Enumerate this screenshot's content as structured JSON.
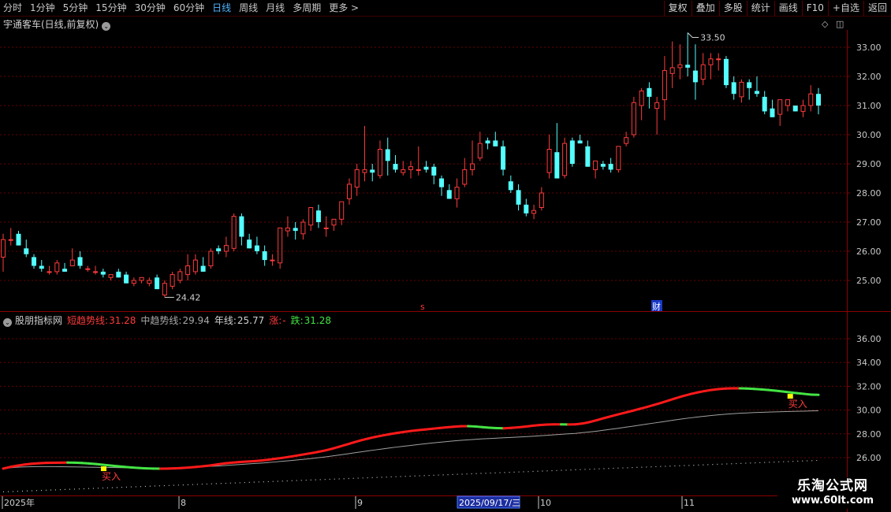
{
  "toolbar": {
    "periods": [
      "分时",
      "1分钟",
      "5分钟",
      "15分钟",
      "30分钟",
      "60分钟",
      "日线",
      "周线",
      "月线",
      "多周期",
      "更多 >"
    ],
    "active_period": "日线",
    "actions": [
      "复权",
      "叠加",
      "多股",
      "统计",
      "画线",
      "F10",
      "+自选",
      "返回"
    ]
  },
  "main_chart": {
    "title": "宇通客车(日线,前复权)",
    "high_label": "33.50",
    "low_label": "24.42",
    "price_ticks": [
      "33.00",
      "32.00",
      "31.00",
      "30.00",
      "29.00",
      "28.00",
      "27.00",
      "26.00",
      "25.00"
    ],
    "marker_s": "s",
    "marker_cai": "财"
  },
  "indicator": {
    "name": "股朋指标网",
    "short_label": "短趋势线:",
    "short_value": "31.28",
    "mid_label": "中趋势线:",
    "mid_value": "29.94",
    "year_label": "年线:",
    "year_value": "25.77",
    "up_label": "涨:",
    "up_value": "-",
    "down_label": "跌:",
    "down_value": "31.28",
    "ticks": [
      "36.00",
      "34.00",
      "32.00",
      "30.00",
      "28.00",
      "26.00"
    ],
    "buy_label": "买入"
  },
  "date_axis": {
    "labels": [
      "2025年",
      "8",
      "9",
      "10",
      "11"
    ],
    "cursor_date": "2025/09/17/三"
  },
  "logo": {
    "line1": "乐淘公式网",
    "line2": "www.60lt.com"
  },
  "colors": {
    "up": "#ff3b3b",
    "down": "#54ffff",
    "trend_up": "#ff1a1a",
    "trend_down": "#44e444",
    "mid": "#a0a0a0",
    "grid": "#6a0000",
    "buy_marker": "#ffff00"
  },
  "chart_data": {
    "type": "candlestick",
    "candles": [
      [
        25.8,
        26.6,
        25.3,
        26.4
      ],
      [
        26.4,
        26.8,
        26.2,
        26.4
      ],
      [
        26.6,
        26.7,
        26.2,
        26.2
      ],
      [
        26.1,
        26.4,
        25.8,
        25.9
      ],
      [
        25.8,
        25.9,
        25.4,
        25.5
      ],
      [
        25.5,
        25.7,
        25.3,
        25.4
      ],
      [
        25.3,
        25.5,
        25.2,
        25.3
      ],
      [
        25.3,
        25.7,
        25.2,
        25.6
      ],
      [
        25.4,
        25.6,
        25.3,
        25.3
      ],
      [
        25.5,
        26.1,
        25.5,
        25.7
      ],
      [
        25.8,
        26.0,
        25.4,
        25.5
      ],
      [
        25.4,
        25.5,
        25.3,
        25.4
      ],
      [
        25.3,
        25.5,
        25.2,
        25.3
      ],
      [
        25.3,
        25.4,
        25.1,
        25.2
      ],
      [
        25.1,
        25.2,
        25.0,
        25.2
      ],
      [
        25.3,
        25.4,
        25.1,
        25.1
      ],
      [
        25.2,
        25.3,
        24.9,
        24.9
      ],
      [
        24.9,
        25.1,
        24.8,
        25.0
      ],
      [
        25.0,
        25.1,
        24.9,
        25.1
      ],
      [
        24.9,
        25.1,
        24.8,
        25.0
      ],
      [
        25.1,
        25.2,
        24.7,
        24.7
      ],
      [
        24.5,
        25.0,
        24.42,
        24.9
      ],
      [
        24.8,
        25.3,
        24.7,
        25.2
      ],
      [
        25.0,
        25.4,
        24.9,
        25.3
      ],
      [
        25.2,
        25.9,
        25.0,
        25.5
      ],
      [
        25.3,
        25.9,
        25.2,
        25.7
      ],
      [
        25.5,
        25.8,
        25.3,
        25.3
      ],
      [
        25.5,
        26.1,
        25.4,
        26.0
      ],
      [
        26.1,
        26.2,
        25.9,
        26.0
      ],
      [
        26.0,
        26.5,
        25.8,
        26.2
      ],
      [
        26.1,
        27.3,
        26.0,
        27.2
      ],
      [
        27.2,
        27.3,
        26.2,
        26.5
      ],
      [
        26.4,
        26.6,
        26.1,
        26.1
      ],
      [
        26.2,
        26.5,
        25.9,
        26.0
      ],
      [
        26.0,
        26.2,
        25.5,
        25.7
      ],
      [
        25.7,
        25.9,
        25.5,
        25.7
      ],
      [
        25.6,
        26.8,
        25.4,
        26.8
      ],
      [
        26.7,
        27.2,
        26.5,
        26.8
      ],
      [
        26.8,
        27.0,
        26.4,
        26.7
      ],
      [
        26.6,
        27.1,
        26.4,
        27.0
      ],
      [
        26.9,
        27.4,
        26.7,
        27.5
      ],
      [
        27.4,
        27.6,
        26.8,
        27.0
      ],
      [
        26.8,
        27.2,
        26.5,
        26.8
      ],
      [
        26.9,
        27.1,
        26.7,
        27.1
      ],
      [
        27.1,
        27.5,
        26.9,
        27.7
      ],
      [
        27.8,
        28.5,
        27.6,
        28.3
      ],
      [
        28.2,
        29.0,
        27.9,
        28.8
      ],
      [
        28.7,
        30.3,
        28.4,
        28.8
      ],
      [
        28.8,
        29.0,
        28.4,
        28.7
      ],
      [
        28.6,
        29.8,
        28.5,
        29.5
      ],
      [
        29.5,
        29.9,
        28.6,
        29.1
      ],
      [
        29.0,
        29.3,
        28.7,
        28.8
      ],
      [
        28.7,
        29.1,
        28.6,
        28.8
      ],
      [
        28.8,
        29.1,
        28.5,
        28.9
      ],
      [
        28.8,
        29.6,
        28.6,
        28.8
      ],
      [
        28.9,
        29.1,
        28.7,
        28.8
      ],
      [
        28.9,
        29.0,
        28.3,
        28.6
      ],
      [
        28.5,
        28.6,
        27.9,
        28.2
      ],
      [
        28.1,
        28.3,
        27.8,
        27.8
      ],
      [
        27.8,
        28.5,
        27.5,
        28.2
      ],
      [
        28.3,
        29.2,
        28.2,
        28.8
      ],
      [
        28.8,
        29.8,
        28.6,
        29.0
      ],
      [
        29.2,
        30.1,
        29.1,
        29.7
      ],
      [
        29.8,
        29.9,
        29.5,
        29.7
      ],
      [
        29.8,
        30.1,
        29.6,
        29.6
      ],
      [
        29.6,
        29.8,
        28.6,
        28.8
      ],
      [
        28.4,
        28.6,
        28.0,
        28.1
      ],
      [
        28.1,
        28.3,
        27.4,
        27.6
      ],
      [
        27.6,
        27.8,
        27.2,
        27.3
      ],
      [
        27.3,
        27.6,
        27.1,
        27.4
      ],
      [
        27.5,
        28.2,
        27.4,
        28.0
      ],
      [
        28.7,
        30.0,
        28.5,
        29.5
      ],
      [
        29.4,
        30.4,
        28.5,
        28.5
      ],
      [
        28.6,
        29.9,
        28.5,
        29.7
      ],
      [
        29.8,
        29.9,
        28.9,
        29.0
      ],
      [
        29.8,
        30.0,
        29.7,
        29.7
      ],
      [
        29.6,
        29.8,
        28.9,
        28.9
      ],
      [
        28.8,
        29.0,
        28.5,
        29.1
      ],
      [
        29.0,
        29.1,
        28.8,
        28.9
      ],
      [
        29.0,
        29.2,
        28.7,
        28.8
      ],
      [
        28.8,
        29.2,
        28.7,
        29.6
      ],
      [
        29.7,
        30.1,
        29.6,
        29.9
      ],
      [
        30.0,
        31.3,
        29.9,
        31.1
      ],
      [
        31.0,
        31.6,
        30.5,
        31.5
      ],
      [
        31.6,
        31.8,
        30.9,
        31.3
      ],
      [
        30.9,
        31.3,
        30.0,
        31.1
      ],
      [
        31.2,
        32.7,
        30.5,
        32.2
      ],
      [
        32.1,
        33.2,
        31.6,
        32.3
      ],
      [
        32.3,
        33.1,
        31.9,
        32.4
      ],
      [
        32.4,
        33.5,
        32.0,
        32.3
      ],
      [
        32.2,
        33.1,
        31.2,
        31.8
      ],
      [
        31.9,
        32.8,
        31.7,
        32.4
      ],
      [
        32.4,
        32.8,
        31.9,
        32.6
      ],
      [
        32.6,
        32.8,
        32.2,
        32.6
      ],
      [
        32.6,
        32.7,
        31.6,
        31.7
      ],
      [
        31.8,
        32.0,
        31.2,
        31.4
      ],
      [
        31.3,
        31.9,
        31.1,
        31.8
      ],
      [
        31.8,
        31.9,
        31.2,
        31.6
      ],
      [
        31.5,
        32.0,
        31.3,
        31.4
      ],
      [
        31.3,
        31.5,
        30.7,
        30.8
      ],
      [
        30.9,
        31.2,
        30.6,
        30.6
      ],
      [
        30.7,
        31.0,
        30.3,
        31.2
      ],
      [
        31.0,
        31.2,
        30.8,
        31.2
      ],
      [
        31.0,
        31.0,
        30.8,
        30.8
      ],
      [
        30.8,
        31.2,
        30.6,
        31.0
      ],
      [
        31.0,
        31.7,
        30.8,
        31.4
      ],
      [
        31.4,
        31.6,
        30.7,
        31.0
      ]
    ],
    "short_trend": [
      25.08,
      25.22,
      25.33,
      25.42,
      25.49,
      25.53,
      25.56,
      25.57,
      25.58,
      25.59,
      25.58,
      25.55,
      25.51,
      25.46,
      25.4,
      25.34,
      25.28,
      25.22,
      25.17,
      25.13,
      25.1,
      25.08,
      25.07,
      25.08,
      25.1,
      25.13,
      25.17,
      25.22,
      25.28,
      25.35,
      25.44,
      25.52,
      25.58,
      25.63,
      25.67,
      25.7,
      25.75,
      25.82,
      25.9,
      25.98,
      26.07,
      26.17,
      26.27,
      26.37,
      26.48,
      26.6,
      26.75,
      26.92,
      27.1,
      27.28,
      27.45,
      27.6,
      27.74,
      27.86,
      27.97,
      28.07,
      28.16,
      28.24,
      28.31,
      28.37,
      28.43,
      28.49,
      28.55,
      28.6,
      28.64,
      28.65,
      28.62,
      28.57,
      28.52,
      28.48,
      28.47,
      28.5,
      28.55,
      28.61,
      28.68,
      28.74,
      28.78,
      28.8,
      28.8,
      28.79,
      28.8,
      28.87,
      28.99,
      29.15,
      29.32,
      29.48,
      29.64,
      29.79,
      29.94,
      30.1,
      30.26,
      30.43,
      30.61,
      30.8,
      30.99,
      31.17,
      31.33,
      31.47,
      31.59,
      31.69,
      31.76,
      31.81,
      31.83,
      31.83,
      31.81,
      31.78,
      31.74,
      31.69,
      31.63,
      31.56,
      31.49,
      31.42,
      31.36,
      31.3,
      31.28
    ],
    "mid_trend": [
      25.1,
      25.15,
      25.2,
      25.22,
      25.24,
      25.25,
      25.25,
      25.25,
      25.24,
      25.23,
      25.22,
      25.21,
      25.2,
      25.19,
      25.18,
      25.17,
      25.16,
      25.15,
      25.14,
      25.14,
      25.13,
      25.13,
      25.13,
      25.14,
      25.15,
      25.17,
      25.19,
      25.21,
      25.24,
      25.27,
      25.3,
      25.34,
      25.38,
      25.42,
      25.46,
      25.5,
      25.54,
      25.59,
      25.64,
      25.69,
      25.74,
      25.8,
      25.86,
      25.92,
      25.99,
      26.06,
      26.14,
      26.22,
      26.31,
      26.4,
      26.48,
      26.57,
      26.65,
      26.73,
      26.81,
      26.89,
      26.96,
      27.03,
      27.1,
      27.17,
      27.23,
      27.29,
      27.35,
      27.41,
      27.46,
      27.5,
      27.54,
      27.58,
      27.61,
      27.64,
      27.67,
      27.7,
      27.73,
      27.76,
      27.8,
      27.84,
      27.88,
      27.92,
      27.96,
      28.0,
      28.04,
      28.1,
      28.16,
      28.23,
      28.31,
      28.39,
      28.47,
      28.56,
      28.64,
      28.73,
      28.82,
      28.91,
      29.0,
      29.09,
      29.18,
      29.26,
      29.34,
      29.41,
      29.48,
      29.54,
      29.6,
      29.65,
      29.69,
      29.73,
      29.76,
      29.79,
      29.81,
      29.83,
      29.85,
      29.87,
      29.88,
      29.9,
      29.91,
      29.93,
      29.94
    ],
    "year_line_start": 24.05,
    "year_line_end": 25.77,
    "buy_signals": [
      14,
      110,
      168,
      267
    ]
  }
}
